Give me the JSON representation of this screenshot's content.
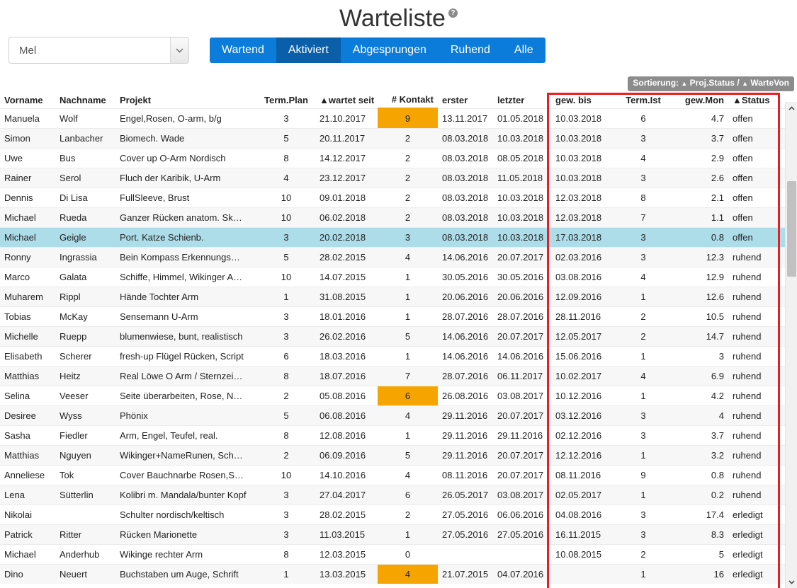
{
  "header": {
    "title": "Warteliste",
    "help_icon": "help-circle-icon"
  },
  "filter": {
    "selected": "Mel",
    "icon": "chevron-down-icon"
  },
  "tabs": [
    {
      "label": "Wartend",
      "active": false
    },
    {
      "label": "Aktiviert",
      "active": true
    },
    {
      "label": "Abgesprungen",
      "active": false
    },
    {
      "label": "Ruhend",
      "active": false
    },
    {
      "label": "Alle",
      "active": false
    }
  ],
  "sorting": {
    "label": "Sortierung:",
    "first": "Proj.Status",
    "separator": "/",
    "second": "WarteVon",
    "caret": "▲"
  },
  "colors": {
    "accent_blue": "#0c7cdb",
    "active_blue": "#0a5fa8",
    "highlight_orange": "#f5a400",
    "selected_row": "#addde9",
    "red_box": "#ee1c20",
    "badge_gray": "#8c8c8c"
  },
  "table": {
    "columns": [
      {
        "key": "vorname",
        "label": "Vorname",
        "sorted": false
      },
      {
        "key": "nachname",
        "label": "Nachname",
        "sorted": false
      },
      {
        "key": "projekt",
        "label": "Projekt",
        "sorted": false
      },
      {
        "key": "termplan",
        "label": "Term.Plan",
        "sorted": false
      },
      {
        "key": "wartetseit",
        "label": "wartet seit",
        "sorted": true
      },
      {
        "key": "kontakt",
        "label": "# Kontakt",
        "sorted": false
      },
      {
        "key": "erster",
        "label": "erster",
        "sorted": false
      },
      {
        "key": "letzter",
        "label": "letzter",
        "sorted": false
      },
      {
        "key": "gewbis",
        "label": "gew. bis",
        "sorted": false
      },
      {
        "key": "termist",
        "label": "Term.Ist",
        "sorted": false
      },
      {
        "key": "gewmon",
        "label": "gew.Mon",
        "sorted": false
      },
      {
        "key": "status",
        "label": "Status",
        "sorted": true
      }
    ],
    "rows": [
      {
        "vorname": "Manuela",
        "nachname": "Wolf",
        "projekt": "Engel,Rosen, O-arm, b/g",
        "termplan": "3",
        "wartetseit": "21.10.2017",
        "kontakt": "9",
        "kontakt_hot": true,
        "erster": "13.11.2017",
        "letzter": "01.05.2018",
        "gewbis": "10.03.2018",
        "termist": "6",
        "gewmon": "4.7",
        "status": "offen",
        "selected": false
      },
      {
        "vorname": "Simon",
        "nachname": "Lanbacher",
        "projekt": "Biomech. Wade",
        "termplan": "5",
        "wartetseit": "20.11.2017",
        "kontakt": "2",
        "kontakt_hot": false,
        "erster": "08.03.2018",
        "letzter": "10.03.2018",
        "gewbis": "10.03.2018",
        "termist": "3",
        "gewmon": "3.7",
        "status": "offen",
        "selected": false
      },
      {
        "vorname": "Uwe",
        "nachname": "Bus",
        "projekt": "Cover up O-Arm Nordisch",
        "termplan": "8",
        "wartetseit": "14.12.2017",
        "kontakt": "2",
        "kontakt_hot": false,
        "erster": "08.03.2018",
        "letzter": "08.05.2018",
        "gewbis": "10.03.2018",
        "termist": "4",
        "gewmon": "2.9",
        "status": "offen",
        "selected": false
      },
      {
        "vorname": "Rainer",
        "nachname": "Serol",
        "projekt": "Fluch der Karibik, U-Arm",
        "termplan": "4",
        "wartetseit": "23.12.2017",
        "kontakt": "2",
        "kontakt_hot": false,
        "erster": "08.03.2018",
        "letzter": "11.05.2018",
        "gewbis": "10.03.2018",
        "termist": "3",
        "gewmon": "2.6",
        "status": "offen",
        "selected": false
      },
      {
        "vorname": "Dennis",
        "nachname": "Di Lisa",
        "projekt": "FullSleeve, Brust",
        "termplan": "10",
        "wartetseit": "09.01.2018",
        "kontakt": "2",
        "kontakt_hot": false,
        "erster": "08.03.2018",
        "letzter": "10.03.2018",
        "gewbis": "12.03.2018",
        "termist": "8",
        "gewmon": "2.1",
        "status": "offen",
        "selected": false
      },
      {
        "vorname": "Michael",
        "nachname": "Rueda",
        "projekt": "Ganzer Rücken anatom. Sk…",
        "termplan": "10",
        "wartetseit": "06.02.2018",
        "kontakt": "2",
        "kontakt_hot": false,
        "erster": "08.03.2018",
        "letzter": "10.03.2018",
        "gewbis": "12.03.2018",
        "termist": "7",
        "gewmon": "1.1",
        "status": "offen",
        "selected": false
      },
      {
        "vorname": "Michael",
        "nachname": "Geigle",
        "projekt": "Port. Katze Schienb.",
        "termplan": "3",
        "wartetseit": "20.02.2018",
        "kontakt": "3",
        "kontakt_hot": false,
        "erster": "08.03.2018",
        "letzter": "10.03.2018",
        "gewbis": "17.03.2018",
        "termist": "3",
        "gewmon": "0.8",
        "status": "offen",
        "selected": true
      },
      {
        "vorname": "Ronny",
        "nachname": "Ingrassia",
        "projekt": "Bein Kompass Erkennungs…",
        "termplan": "5",
        "wartetseit": "28.02.2015",
        "kontakt": "4",
        "kontakt_hot": false,
        "erster": "14.06.2016",
        "letzter": "20.07.2017",
        "gewbis": "02.03.2016",
        "termist": "3",
        "gewmon": "12.3",
        "status": "ruhend",
        "selected": false
      },
      {
        "vorname": "Marco",
        "nachname": "Galata",
        "projekt": "Schiffe, Himmel, Wikinger A…",
        "termplan": "10",
        "wartetseit": "14.07.2015",
        "kontakt": "1",
        "kontakt_hot": false,
        "erster": "30.05.2016",
        "letzter": "30.05.2016",
        "gewbis": "03.08.2016",
        "termist": "4",
        "gewmon": "12.9",
        "status": "ruhend",
        "selected": false
      },
      {
        "vorname": "Muharem",
        "nachname": "Rippl",
        "projekt": "Hände Tochter Arm",
        "termplan": "1",
        "wartetseit": "31.08.2015",
        "kontakt": "1",
        "kontakt_hot": false,
        "erster": "20.06.2016",
        "letzter": "20.06.2016",
        "gewbis": "12.09.2016",
        "termist": "1",
        "gewmon": "12.6",
        "status": "ruhend",
        "selected": false
      },
      {
        "vorname": "Tobias",
        "nachname": "McKay",
        "projekt": "Sensemann U-Arm",
        "termplan": "3",
        "wartetseit": "18.01.2016",
        "kontakt": "1",
        "kontakt_hot": false,
        "erster": "28.07.2016",
        "letzter": "28.07.2016",
        "gewbis": "28.11.2016",
        "termist": "2",
        "gewmon": "10.5",
        "status": "ruhend",
        "selected": false
      },
      {
        "vorname": "Michelle",
        "nachname": "Ruepp",
        "projekt": "blumenwiese, bunt, realistisch",
        "termplan": "3",
        "wartetseit": "26.02.2016",
        "kontakt": "5",
        "kontakt_hot": false,
        "erster": "14.06.2016",
        "letzter": "20.07.2017",
        "gewbis": "12.05.2017",
        "termist": "2",
        "gewmon": "14.7",
        "status": "ruhend",
        "selected": false
      },
      {
        "vorname": "Elisabeth",
        "nachname": "Scherer",
        "projekt": "fresh-up Flügel Rücken, Script",
        "termplan": "6",
        "wartetseit": "18.03.2016",
        "kontakt": "1",
        "kontakt_hot": false,
        "erster": "14.06.2016",
        "letzter": "14.06.2016",
        "gewbis": "15.06.2016",
        "termist": "1",
        "gewmon": "3",
        "status": "ruhend",
        "selected": false
      },
      {
        "vorname": "Matthias",
        "nachname": "Heitz",
        "projekt": "Real Löwe O Arm / Sternzei…",
        "termplan": "8",
        "wartetseit": "18.07.2016",
        "kontakt": "7",
        "kontakt_hot": false,
        "erster": "28.07.2016",
        "letzter": "06.11.2017",
        "gewbis": "10.02.2017",
        "termist": "4",
        "gewmon": "6.9",
        "status": "ruhend",
        "selected": false
      },
      {
        "vorname": "Selina",
        "nachname": "Veeser",
        "projekt": "Seite überarbeiten, Rose, N…",
        "termplan": "2",
        "wartetseit": "05.08.2016",
        "kontakt": "6",
        "kontakt_hot": true,
        "erster": "26.08.2016",
        "letzter": "03.08.2017",
        "gewbis": "10.12.2016",
        "termist": "1",
        "gewmon": "4.2",
        "status": "ruhend",
        "selected": false
      },
      {
        "vorname": "Desiree",
        "nachname": "Wyss",
        "projekt": "Phönix",
        "termplan": "5",
        "wartetseit": "06.08.2016",
        "kontakt": "4",
        "kontakt_hot": false,
        "erster": "29.11.2016",
        "letzter": "20.07.2017",
        "gewbis": "03.12.2016",
        "termist": "3",
        "gewmon": "4",
        "status": "ruhend",
        "selected": false
      },
      {
        "vorname": "Sasha",
        "nachname": "Fiedler",
        "projekt": "Arm, Engel, Teufel, real.",
        "termplan": "8",
        "wartetseit": "12.08.2016",
        "kontakt": "1",
        "kontakt_hot": false,
        "erster": "29.11.2016",
        "letzter": "29.11.2016",
        "gewbis": "02.12.2016",
        "termist": "3",
        "gewmon": "3.7",
        "status": "ruhend",
        "selected": false
      },
      {
        "vorname": "Matthias",
        "nachname": "Nguyen",
        "projekt": "Wikinger+NameRunen, Sch…",
        "termplan": "2",
        "wartetseit": "06.09.2016",
        "kontakt": "5",
        "kontakt_hot": false,
        "erster": "29.11.2016",
        "letzter": "20.07.2017",
        "gewbis": "12.12.2016",
        "termist": "1",
        "gewmon": "3.2",
        "status": "ruhend",
        "selected": false
      },
      {
        "vorname": "Anneliese",
        "nachname": "Tok",
        "projekt": "Cover Bauchnarbe Rosen,S…",
        "termplan": "10",
        "wartetseit": "14.10.2016",
        "kontakt": "4",
        "kontakt_hot": false,
        "erster": "08.11.2016",
        "letzter": "20.07.2017",
        "gewbis": "08.11.2016",
        "termist": "9",
        "gewmon": "0.8",
        "status": "ruhend",
        "selected": false
      },
      {
        "vorname": "Lena",
        "nachname": "Sütterlin",
        "projekt": "Kolibri m. Mandala/bunter Kopf",
        "termplan": "3",
        "wartetseit": "27.04.2017",
        "kontakt": "6",
        "kontakt_hot": false,
        "erster": "26.05.2017",
        "letzter": "03.08.2017",
        "gewbis": "02.05.2017",
        "termist": "1",
        "gewmon": "0.2",
        "status": "ruhend",
        "selected": false
      },
      {
        "vorname": "Nikolai",
        "nachname": "",
        "projekt": "Schulter nordisch/keltisch",
        "termplan": "3",
        "wartetseit": "28.02.2015",
        "kontakt": "2",
        "kontakt_hot": false,
        "erster": "27.05.2016",
        "letzter": "06.06.2016",
        "gewbis": "04.08.2016",
        "termist": "3",
        "gewmon": "17.4",
        "status": "erledigt",
        "selected": false
      },
      {
        "vorname": "Patrick",
        "nachname": "Ritter",
        "projekt": "Rücken Marionette",
        "termplan": "3",
        "wartetseit": "11.03.2015",
        "kontakt": "1",
        "kontakt_hot": false,
        "erster": "27.05.2016",
        "letzter": "27.05.2016",
        "gewbis": "16.11.2015",
        "termist": "3",
        "gewmon": "8.3",
        "status": "erledigt",
        "selected": false
      },
      {
        "vorname": "Michael",
        "nachname": "Anderhub",
        "projekt": "Wikinge rechter Arm",
        "termplan": "8",
        "wartetseit": "12.03.2015",
        "kontakt": "0",
        "kontakt_hot": false,
        "erster": "",
        "letzter": "",
        "gewbis": "10.08.2015",
        "termist": "2",
        "gewmon": "5",
        "status": "erledigt",
        "selected": false
      },
      {
        "vorname": "Dino",
        "nachname": "Neuert",
        "projekt": "Buchstaben um Auge, Schrift",
        "termplan": "1",
        "wartetseit": "13.03.2015",
        "kontakt": "4",
        "kontakt_hot": true,
        "erster": "21.07.2015",
        "letzter": "04.07.2016",
        "gewbis": "",
        "termist": "1",
        "gewmon": "16",
        "status": "erledigt",
        "selected": false
      }
    ]
  },
  "scrollbar": {
    "up_icon": "chevron-up-icon",
    "down_icon": "chevron-down-icon"
  }
}
